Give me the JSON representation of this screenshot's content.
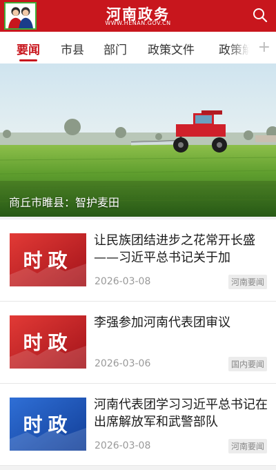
{
  "header": {
    "title": "河南政务",
    "subtitle": "WWW.HENAN.GOV.CN",
    "brand_color": "#c8161d",
    "avatar_icon": "user-avatar-icon",
    "search_icon": "search-icon"
  },
  "tabs": [
    {
      "label": "要闻",
      "active": true
    },
    {
      "label": "市县"
    },
    {
      "label": "部门"
    },
    {
      "label": "政策文件"
    },
    {
      "label": "政策解"
    }
  ],
  "tab_add_label": "+",
  "banner": {
    "caption": "商丘市睢县：智护麦田"
  },
  "news": [
    {
      "thumb_text": "时政",
      "thumb_color": "red",
      "title": "让民族团结进步之花常开长盛——习近平总书记关于加",
      "date": "2026-03-08",
      "tag": "河南要闻"
    },
    {
      "thumb_text": "时政",
      "thumb_color": "red",
      "title": "李强参加河南代表团审议",
      "date": "2026-03-06",
      "tag": "国内要闻"
    },
    {
      "thumb_text": "时政",
      "thumb_color": "blue",
      "title": "河南代表团学习习近平总书记在出席解放军和武警部队",
      "date": "2026-03-08",
      "tag": "河南要闻"
    }
  ]
}
